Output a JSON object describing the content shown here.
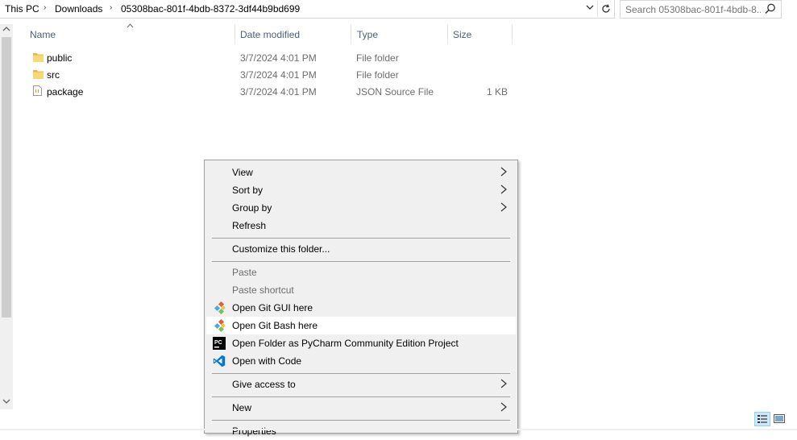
{
  "address": {
    "crumbs": [
      "This PC",
      "Downloads",
      "05308bac-801f-4bdb-8372-3df44b9bd699"
    ],
    "dropdown_icon": "chevron-down-icon",
    "refresh_icon": "refresh-icon"
  },
  "search": {
    "placeholder": "Search 05308bac-801f-4bdb-8...",
    "icon": "search-icon"
  },
  "columns": {
    "name": "Name",
    "date": "Date modified",
    "type": "Type",
    "size": "Size"
  },
  "files": [
    {
      "name": "public",
      "date": "3/7/2024 4:01 PM",
      "type": "File folder",
      "size": "",
      "icon": "folder-icon"
    },
    {
      "name": "src",
      "date": "3/7/2024 4:01 PM",
      "type": "File folder",
      "size": "",
      "icon": "folder-icon"
    },
    {
      "name": "package",
      "date": "3/7/2024 4:01 PM",
      "type": "JSON Source File",
      "size": "1 KB",
      "icon": "file-icon"
    }
  ],
  "context_menu": {
    "view": "View",
    "sort_by": "Sort by",
    "group_by": "Group by",
    "refresh": "Refresh",
    "customize": "Customize this folder...",
    "paste": "Paste",
    "paste_shortcut": "Paste shortcut",
    "git_gui": "Open Git GUI here",
    "git_bash": "Open Git Bash here",
    "pycharm": "Open Folder as PyCharm Community Edition Project",
    "vscode": "Open with Code",
    "give_access": "Give access to",
    "new": "New",
    "properties": "Properties"
  },
  "colors": {
    "header_text": "#4c607a",
    "folder": "#e8b94a",
    "menu_bg": "#f0f0f0",
    "highlight": "#ffffff"
  }
}
